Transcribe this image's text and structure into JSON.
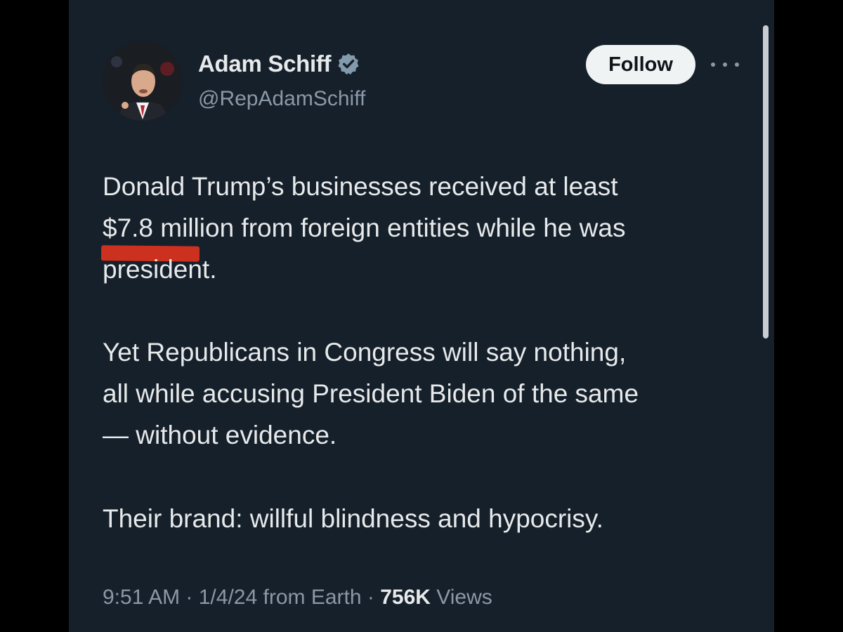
{
  "author": {
    "display_name": "Adam Schiff",
    "handle": "@RepAdamSchiff",
    "verified_icon": "verified-badge-icon"
  },
  "actions": {
    "follow_label": "Follow",
    "more_icon": "more-options-icon"
  },
  "tweet": {
    "paragraph1": [
      "Donald Trump’s businesses received at least",
      "$7.8 million from foreign entities while he was",
      "president."
    ],
    "paragraph2": [
      "Yet Republicans in Congress will say nothing,",
      "all while accusing President Biden of the same",
      "— without evidence."
    ],
    "paragraph3": [
      "Their brand: willful blindness and hypocrisy."
    ]
  },
  "meta": {
    "time": "9:51 AM",
    "sep1": " · ",
    "date": "1/4/24",
    "source": " from Earth",
    "sep2": " · ",
    "views_count": "756K",
    "views_label": " Views"
  },
  "colors": {
    "background": "#15202b",
    "text": "#e7e9ea",
    "secondary": "#8b98a5",
    "verified": "#829aab",
    "annotation_red": "#d6321d"
  }
}
